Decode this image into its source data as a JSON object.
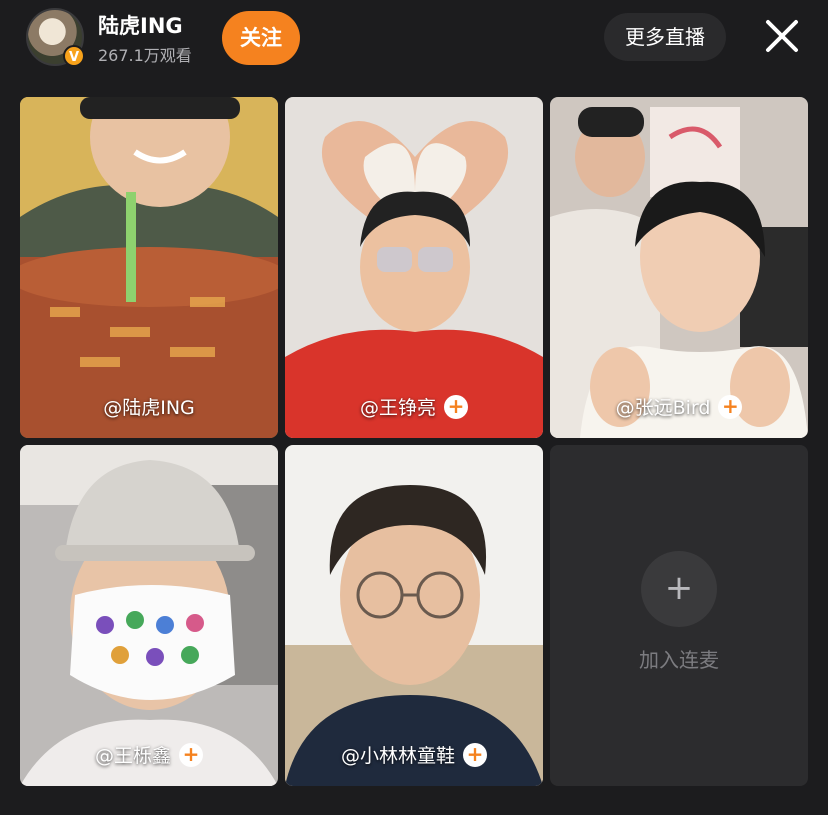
{
  "header": {
    "host_name": "陆虎ING",
    "verified_badge": "V",
    "viewers": "267.1万观看",
    "follow_label": "关注",
    "more_live_label": "更多直播"
  },
  "tiles": [
    {
      "name": "@陆虎ING",
      "show_follow": false
    },
    {
      "name": "@王铮亮",
      "show_follow": true
    },
    {
      "name": "@张远Bird",
      "show_follow": true
    },
    {
      "name": "@王栎鑫",
      "show_follow": true
    },
    {
      "name": "@小林林童鞋",
      "show_follow": true
    }
  ],
  "follow_badge": "+",
  "join": {
    "icon": "+",
    "label": "加入连麦"
  },
  "colors": {
    "accent": "#f5821f",
    "background": "#1c1c1e",
    "badge": "#f7a21b"
  }
}
